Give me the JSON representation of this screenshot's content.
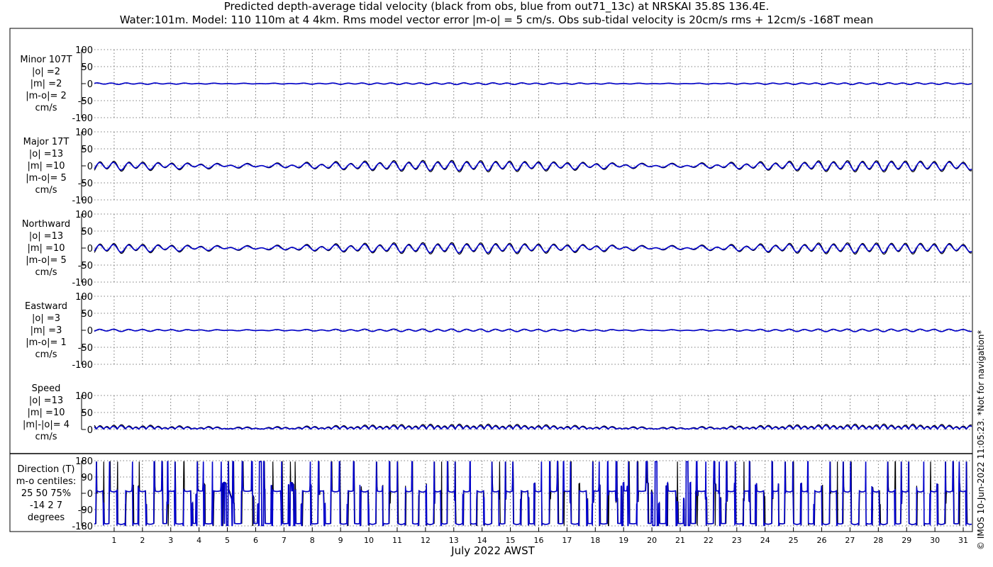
{
  "title_line1": "Predicted depth-average tidal velocity (black from obs, blue from out71_13c) at NRSKAI 35.8S 136.4E.",
  "title_line2": "Water:101m. Model: 110 110m at 4 4km. Rms model vector error |m-o| = 5 cm/s. Obs sub-tidal velocity is 20cm/s rms + 12cm/s -168T mean",
  "side_text": "© IMOS 10-Jun-2022 11:05:23. *Not for navigation*",
  "chart_data": {
    "type": "line",
    "title": "Predicted depth-average tidal velocity (black from obs, blue from out71_13c) at NRSKAI 35.8S 136.4E.",
    "xlabel": "July 2022 AWST",
    "x_ticks": [
      "1",
      "2",
      "3",
      "4",
      "5",
      "6",
      "7",
      "8",
      "9",
      "10",
      "11",
      "12",
      "13",
      "14",
      "15",
      "16",
      "17",
      "18",
      "19",
      "20",
      "21",
      "22",
      "23",
      "24",
      "25",
      "26",
      "27",
      "28",
      "29",
      "30",
      "31"
    ],
    "xlim": [
      0.3,
      31.3
    ],
    "series_colors": {
      "obs": "#000000",
      "model": "#0000cc"
    },
    "grid": true,
    "panels": [
      {
        "label": "Minor 107T\n|o| =2\n|m| =2\n|m-o|= 2\ncm/s",
        "ylim": [
          -100,
          100
        ],
        "yticks": [
          "100",
          "50",
          "0",
          "-50",
          "-100"
        ],
        "amplitude_obs": 2,
        "amplitude_model": 2
      },
      {
        "label": "Major 17T\n|o| =13\n|m| =10\n|m-o|= 5\ncm/s",
        "ylim": [
          -100,
          100
        ],
        "yticks": [
          "100",
          "50",
          "0",
          "-50",
          "-100"
        ],
        "amplitude_obs": 13,
        "amplitude_model": 10
      },
      {
        "label": "Northward\n|o| =13\n|m| =10\n|m-o|= 5\ncm/s",
        "ylim": [
          -100,
          100
        ],
        "yticks": [
          "100",
          "50",
          "0",
          "-50",
          "-100"
        ],
        "amplitude_obs": 13,
        "amplitude_model": 10
      },
      {
        "label": "Eastward\n|o| =3\n|m| =3\n|m-o|= 1\ncm/s",
        "ylim": [
          -100,
          100
        ],
        "yticks": [
          "100",
          "50",
          "0",
          "-50",
          "-100"
        ],
        "amplitude_obs": 3,
        "amplitude_model": 3
      },
      {
        "label": "Speed\n|o| =13\n|m| =10\n|m|-|o|= 4\ncm/s",
        "ylim": [
          0,
          100
        ],
        "yticks": [
          "100",
          "50",
          "0"
        ],
        "amplitude_obs": 13,
        "amplitude_model": 10
      },
      {
        "label": "Direction (T)\nm-o centiles:\n25  50  75%\n-14   2   7\ndegrees",
        "ylim": [
          -180,
          180
        ],
        "yticks": [
          "180",
          "90",
          "0",
          "-90",
          "-180"
        ],
        "centiles": {
          "p25": -14,
          "p50": 2,
          "p75": 7
        }
      }
    ]
  }
}
